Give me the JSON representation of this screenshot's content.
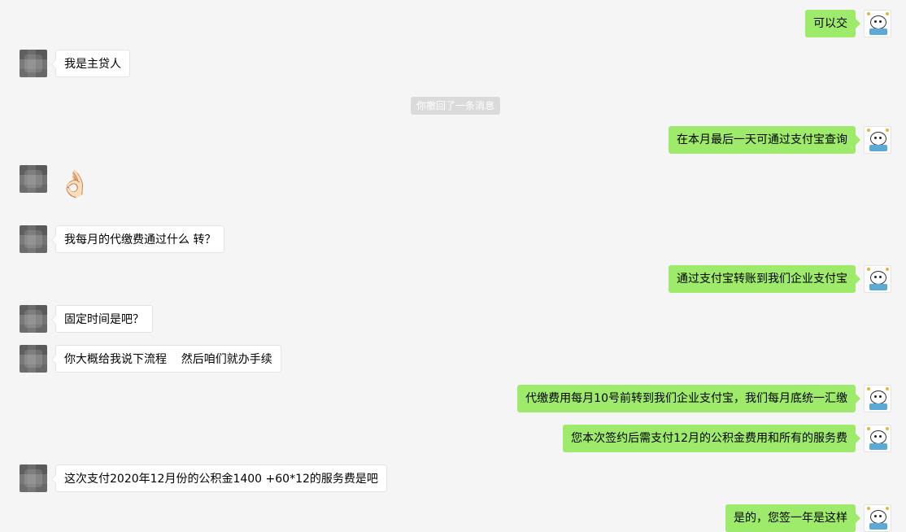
{
  "messages": [
    {
      "side": "me",
      "text": "可以交"
    },
    {
      "side": "other",
      "text": "我是主贷人"
    },
    {
      "side": "system",
      "text": "你撤回了一条消息"
    },
    {
      "side": "me",
      "text": "在本月最后一天可通过支付宝查询"
    },
    {
      "side": "other",
      "emoji": "👌🏻",
      "emoji_name": "ok-hand"
    },
    {
      "side": "other",
      "text": "我每月的代缴费通过什么 转？"
    },
    {
      "side": "me",
      "text": "通过支付宝转账到我们企业支付宝"
    },
    {
      "side": "other",
      "text": "固定时间是吧？"
    },
    {
      "side": "other",
      "text": "你大概给我说下流程    然后咱们就办手续"
    },
    {
      "side": "me",
      "text": "代缴费用每月10号前转到我们企业支付宝，我们每月底统一汇缴"
    },
    {
      "side": "me",
      "text": "您本次签约后需支付12月的公积金费用和所有的服务费"
    },
    {
      "side": "other",
      "text": "这次支付2020年12月份的公积金1400 +60*12的服务费是吧"
    },
    {
      "side": "me",
      "text": "是的，您签一年是这样"
    }
  ],
  "colors": {
    "background": "#f5f5f5",
    "me_bubble": "#9eea6a",
    "other_bubble": "#ffffff",
    "system_tip": "#dadada"
  }
}
